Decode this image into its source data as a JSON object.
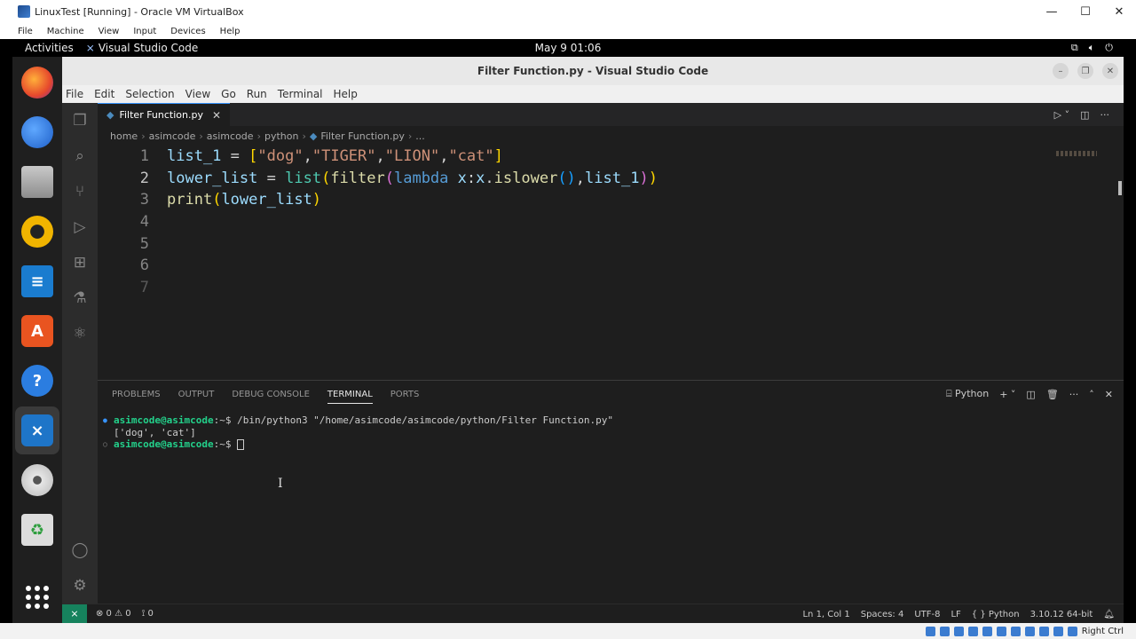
{
  "host": {
    "title": "LinuxTest [Running] - Oracle VM VirtualBox",
    "menu": [
      "File",
      "Machine",
      "View",
      "Input",
      "Devices",
      "Help"
    ],
    "status_host_key": "Right Ctrl"
  },
  "gnome": {
    "activities": "Activities",
    "focused_app": "Visual Studio Code",
    "clock": "May 9  01:06"
  },
  "vscode": {
    "window_title": "Filter Function.py - Visual Studio Code",
    "menu": [
      "File",
      "Edit",
      "Selection",
      "View",
      "Go",
      "Run",
      "Terminal",
      "Help"
    ],
    "tab": {
      "label": "Filter Function.py",
      "close": "✕"
    },
    "breadcrumb": [
      "home",
      "asimcode",
      "asimcode",
      "python",
      "Filter Function.py",
      "..."
    ],
    "line_numbers": [
      "1",
      "2",
      "3",
      "4",
      "5",
      "6",
      "7"
    ],
    "code_lines": [
      "list_1 = [\"dog\",\"TIGER\",\"LION\",\"cat\"]",
      "lower_list = list(filter(lambda x:x.islower(),list_1))",
      "print(lower_list)"
    ],
    "panel": {
      "tabs": [
        "PROBLEMS",
        "OUTPUT",
        "DEBUG CONSOLE",
        "TERMINAL",
        "PORTS"
      ],
      "active_tab": "TERMINAL",
      "profile": "Python"
    },
    "terminal": {
      "prompt_user": "asimcode@asimcode",
      "prompt_path": ":~$",
      "command": " /bin/python3 \"/home/asimcode/asimcode/python/Filter Function.py\"",
      "output": "['dog', 'cat']"
    },
    "status": {
      "errors": "⊗ 0 ⚠ 0",
      "ports": "⟟ 0",
      "position": "Ln 1, Col 1",
      "spaces": "Spaces: 4",
      "encoding": "UTF-8",
      "eol": "LF",
      "language": "Python",
      "interpreter": "3.10.12 64-bit"
    }
  }
}
